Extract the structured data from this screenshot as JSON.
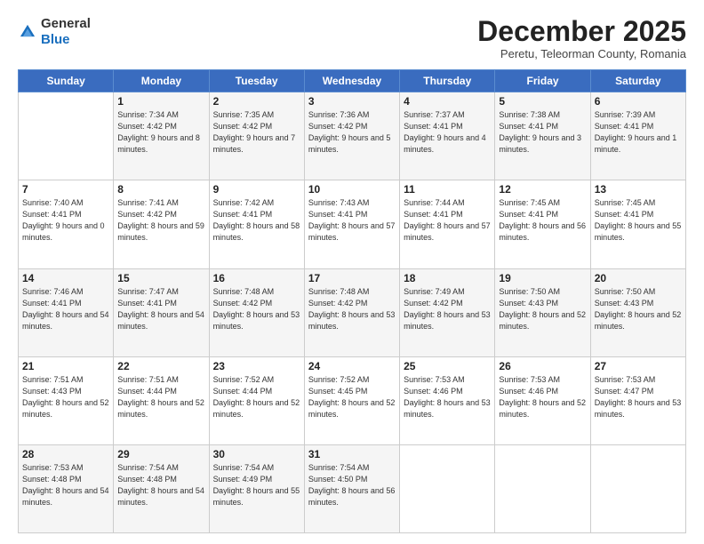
{
  "logo": {
    "general": "General",
    "blue": "Blue"
  },
  "header": {
    "month": "December 2025",
    "location": "Peretu, Teleorman County, Romania"
  },
  "weekdays": [
    "Sunday",
    "Monday",
    "Tuesday",
    "Wednesday",
    "Thursday",
    "Friday",
    "Saturday"
  ],
  "weeks": [
    [
      {
        "day": "",
        "sunrise": "",
        "sunset": "",
        "daylight": ""
      },
      {
        "day": "1",
        "sunrise": "Sunrise: 7:34 AM",
        "sunset": "Sunset: 4:42 PM",
        "daylight": "Daylight: 9 hours and 8 minutes."
      },
      {
        "day": "2",
        "sunrise": "Sunrise: 7:35 AM",
        "sunset": "Sunset: 4:42 PM",
        "daylight": "Daylight: 9 hours and 7 minutes."
      },
      {
        "day": "3",
        "sunrise": "Sunrise: 7:36 AM",
        "sunset": "Sunset: 4:42 PM",
        "daylight": "Daylight: 9 hours and 5 minutes."
      },
      {
        "day": "4",
        "sunrise": "Sunrise: 7:37 AM",
        "sunset": "Sunset: 4:41 PM",
        "daylight": "Daylight: 9 hours and 4 minutes."
      },
      {
        "day": "5",
        "sunrise": "Sunrise: 7:38 AM",
        "sunset": "Sunset: 4:41 PM",
        "daylight": "Daylight: 9 hours and 3 minutes."
      },
      {
        "day": "6",
        "sunrise": "Sunrise: 7:39 AM",
        "sunset": "Sunset: 4:41 PM",
        "daylight": "Daylight: 9 hours and 1 minute."
      }
    ],
    [
      {
        "day": "7",
        "sunrise": "Sunrise: 7:40 AM",
        "sunset": "Sunset: 4:41 PM",
        "daylight": "Daylight: 9 hours and 0 minutes."
      },
      {
        "day": "8",
        "sunrise": "Sunrise: 7:41 AM",
        "sunset": "Sunset: 4:42 PM",
        "daylight": "Daylight: 8 hours and 59 minutes."
      },
      {
        "day": "9",
        "sunrise": "Sunrise: 7:42 AM",
        "sunset": "Sunset: 4:41 PM",
        "daylight": "Daylight: 8 hours and 58 minutes."
      },
      {
        "day": "10",
        "sunrise": "Sunrise: 7:43 AM",
        "sunset": "Sunset: 4:41 PM",
        "daylight": "Daylight: 8 hours and 57 minutes."
      },
      {
        "day": "11",
        "sunrise": "Sunrise: 7:44 AM",
        "sunset": "Sunset: 4:41 PM",
        "daylight": "Daylight: 8 hours and 57 minutes."
      },
      {
        "day": "12",
        "sunrise": "Sunrise: 7:45 AM",
        "sunset": "Sunset: 4:41 PM",
        "daylight": "Daylight: 8 hours and 56 minutes."
      },
      {
        "day": "13",
        "sunrise": "Sunrise: 7:45 AM",
        "sunset": "Sunset: 4:41 PM",
        "daylight": "Daylight: 8 hours and 55 minutes."
      }
    ],
    [
      {
        "day": "14",
        "sunrise": "Sunrise: 7:46 AM",
        "sunset": "Sunset: 4:41 PM",
        "daylight": "Daylight: 8 hours and 54 minutes."
      },
      {
        "day": "15",
        "sunrise": "Sunrise: 7:47 AM",
        "sunset": "Sunset: 4:41 PM",
        "daylight": "Daylight: 8 hours and 54 minutes."
      },
      {
        "day": "16",
        "sunrise": "Sunrise: 7:48 AM",
        "sunset": "Sunset: 4:42 PM",
        "daylight": "Daylight: 8 hours and 53 minutes."
      },
      {
        "day": "17",
        "sunrise": "Sunrise: 7:48 AM",
        "sunset": "Sunset: 4:42 PM",
        "daylight": "Daylight: 8 hours and 53 minutes."
      },
      {
        "day": "18",
        "sunrise": "Sunrise: 7:49 AM",
        "sunset": "Sunset: 4:42 PM",
        "daylight": "Daylight: 8 hours and 53 minutes."
      },
      {
        "day": "19",
        "sunrise": "Sunrise: 7:50 AM",
        "sunset": "Sunset: 4:43 PM",
        "daylight": "Daylight: 8 hours and 52 minutes."
      },
      {
        "day": "20",
        "sunrise": "Sunrise: 7:50 AM",
        "sunset": "Sunset: 4:43 PM",
        "daylight": "Daylight: 8 hours and 52 minutes."
      }
    ],
    [
      {
        "day": "21",
        "sunrise": "Sunrise: 7:51 AM",
        "sunset": "Sunset: 4:43 PM",
        "daylight": "Daylight: 8 hours and 52 minutes."
      },
      {
        "day": "22",
        "sunrise": "Sunrise: 7:51 AM",
        "sunset": "Sunset: 4:44 PM",
        "daylight": "Daylight: 8 hours and 52 minutes."
      },
      {
        "day": "23",
        "sunrise": "Sunrise: 7:52 AM",
        "sunset": "Sunset: 4:44 PM",
        "daylight": "Daylight: 8 hours and 52 minutes."
      },
      {
        "day": "24",
        "sunrise": "Sunrise: 7:52 AM",
        "sunset": "Sunset: 4:45 PM",
        "daylight": "Daylight: 8 hours and 52 minutes."
      },
      {
        "day": "25",
        "sunrise": "Sunrise: 7:53 AM",
        "sunset": "Sunset: 4:46 PM",
        "daylight": "Daylight: 8 hours and 53 minutes."
      },
      {
        "day": "26",
        "sunrise": "Sunrise: 7:53 AM",
        "sunset": "Sunset: 4:46 PM",
        "daylight": "Daylight: 8 hours and 52 minutes."
      },
      {
        "day": "27",
        "sunrise": "Sunrise: 7:53 AM",
        "sunset": "Sunset: 4:47 PM",
        "daylight": "Daylight: 8 hours and 53 minutes."
      }
    ],
    [
      {
        "day": "28",
        "sunrise": "Sunrise: 7:53 AM",
        "sunset": "Sunset: 4:48 PM",
        "daylight": "Daylight: 8 hours and 54 minutes."
      },
      {
        "day": "29",
        "sunrise": "Sunrise: 7:54 AM",
        "sunset": "Sunset: 4:48 PM",
        "daylight": "Daylight: 8 hours and 54 minutes."
      },
      {
        "day": "30",
        "sunrise": "Sunrise: 7:54 AM",
        "sunset": "Sunset: 4:49 PM",
        "daylight": "Daylight: 8 hours and 55 minutes."
      },
      {
        "day": "31",
        "sunrise": "Sunrise: 7:54 AM",
        "sunset": "Sunset: 4:50 PM",
        "daylight": "Daylight: 8 hours and 56 minutes."
      },
      {
        "day": "",
        "sunrise": "",
        "sunset": "",
        "daylight": ""
      },
      {
        "day": "",
        "sunrise": "",
        "sunset": "",
        "daylight": ""
      },
      {
        "day": "",
        "sunrise": "",
        "sunset": "",
        "daylight": ""
      }
    ]
  ]
}
